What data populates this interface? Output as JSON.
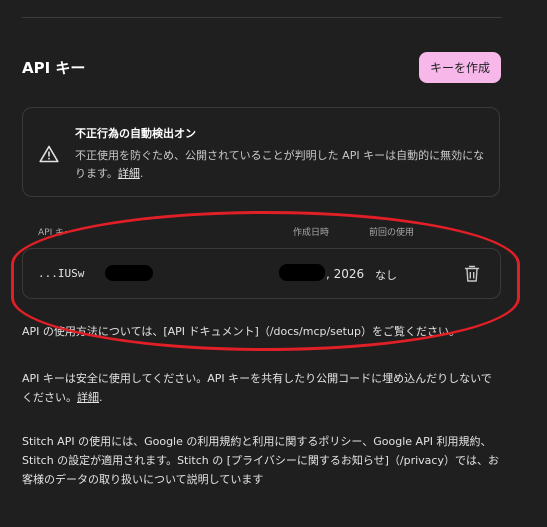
{
  "header": {
    "title": "API キー",
    "create_button": "キーを作成"
  },
  "notice": {
    "title": "不正行為の自動検出オン",
    "body": "不正使用を防ぐため、公開されていることが判明した API キーは自動的に無効になります。",
    "link": "詳細",
    "icon": "warning-icon"
  },
  "table": {
    "columns": [
      "API キー",
      "作成日時",
      "前回の使用"
    ],
    "rows": [
      {
        "key": "...IUSw",
        "created": ", 2026",
        "last_used": "なし"
      }
    ]
  },
  "usage_note": "API の使用方法については、[API ドキュメント]（/docs/mcp/setup）をご覧ください。",
  "safety": {
    "text": "API キーは安全に使用してください。API キーを共有したり公開コードに埋め込んだりしないでください。",
    "link": "詳細"
  },
  "terms": "Stitch API の使用には、Google の利用規約と利用に関するポリシー、Google API 利用規約、Stitch の設定が適用されます。Stitch の [プライバシーに関するお知らせ]（/privacy）では、お客様のデータの取り扱いについて説明しています",
  "colors": {
    "accent": "#f7b7e9",
    "annotation": "#e01f26",
    "background": "#1f1f1f"
  }
}
